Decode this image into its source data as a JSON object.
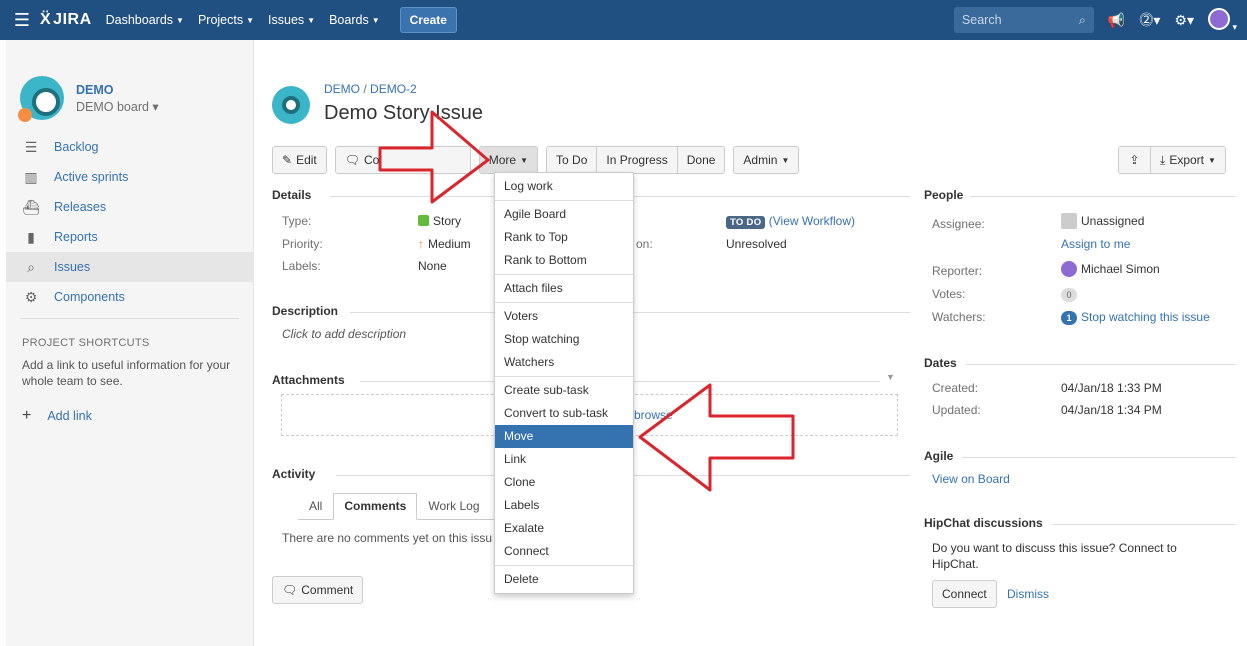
{
  "nav": {
    "logo": "JIRA",
    "items": [
      "Dashboards",
      "Projects",
      "Issues",
      "Boards"
    ],
    "create": "Create",
    "search_placeholder": "Search"
  },
  "sidebar": {
    "project_name": "DEMO",
    "board_name": "DEMO board",
    "items": [
      {
        "label": "Backlog",
        "icon": "backlog-icon"
      },
      {
        "label": "Active sprints",
        "icon": "sprint-board-icon"
      },
      {
        "label": "Releases",
        "icon": "ship-icon"
      },
      {
        "label": "Reports",
        "icon": "chart-icon"
      },
      {
        "label": "Issues",
        "icon": "issues-search-icon"
      },
      {
        "label": "Components",
        "icon": "puzzle-icon"
      }
    ],
    "shortcuts_heading": "PROJECT SHORTCUTS",
    "shortcuts_desc": "Add a link to useful information for your whole team to see.",
    "add_link": "Add link"
  },
  "issue": {
    "breadcrumb_project": "DEMO",
    "breadcrumb_sep": "/",
    "breadcrumb_key": "DEMO-2",
    "title": "Demo Story Issue"
  },
  "toolbar": {
    "edit": "Edit",
    "comment_partial": "Co",
    "more": "More",
    "todo": "To Do",
    "in_progress": "In Progress",
    "done": "Done",
    "admin": "Admin",
    "export": "Export"
  },
  "details": {
    "heading": "Details",
    "type_label": "Type:",
    "type_value": "Story",
    "priority_label": "Priority:",
    "priority_value": "Medium",
    "labels_label": "Labels:",
    "labels_value": "None",
    "resolution_label_partial": "on:",
    "status_badge": "TO DO",
    "view_workflow": "(View Workflow)",
    "resolution_value": "Unresolved"
  },
  "description": {
    "heading": "Description",
    "placeholder": "Click to add description"
  },
  "attachments": {
    "heading": "Attachments",
    "browse_partial": "browse"
  },
  "activity": {
    "heading": "Activity",
    "tabs": [
      "All",
      "Comments",
      "Work Log",
      ""
    ],
    "empty_partial": "There are no comments yet on this issu",
    "comment_button": "Comment"
  },
  "more_menu": {
    "items": [
      "Log work",
      "Agile Board",
      "Rank to Top",
      "Rank to Bottom",
      "Attach files",
      "Voters",
      "Stop watching",
      "Watchers",
      "Create sub-task",
      "Convert to sub-task",
      "Move",
      "Link",
      "Clone",
      "Labels",
      "Exalate",
      "Connect",
      "Delete"
    ],
    "highlighted": "Move"
  },
  "people": {
    "heading": "People",
    "assignee_label": "Assignee:",
    "assignee_value": "Unassigned",
    "assign_to_me": "Assign to me",
    "reporter_label": "Reporter:",
    "reporter_value": "Michael Simon",
    "votes_label": "Votes:",
    "votes_value": "0",
    "watchers_label": "Watchers:",
    "watchers_count": "1",
    "watchers_action": "Stop watching this issue"
  },
  "dates": {
    "heading": "Dates",
    "created_label": "Created:",
    "created_value": "04/Jan/18 1:33 PM",
    "updated_label": "Updated:",
    "updated_value": "04/Jan/18 1:34 PM"
  },
  "agile": {
    "heading": "Agile",
    "view_on_board": "View on Board"
  },
  "hipchat": {
    "heading": "HipChat discussions",
    "desc": "Do you want to discuss this issue? Connect to HipChat.",
    "connect": "Connect",
    "dismiss": "Dismiss"
  },
  "colors": {
    "nav_bg": "#205081",
    "link": "#3572b0",
    "menu_highlight": "#3572b0",
    "arrow": "#d9262c"
  }
}
